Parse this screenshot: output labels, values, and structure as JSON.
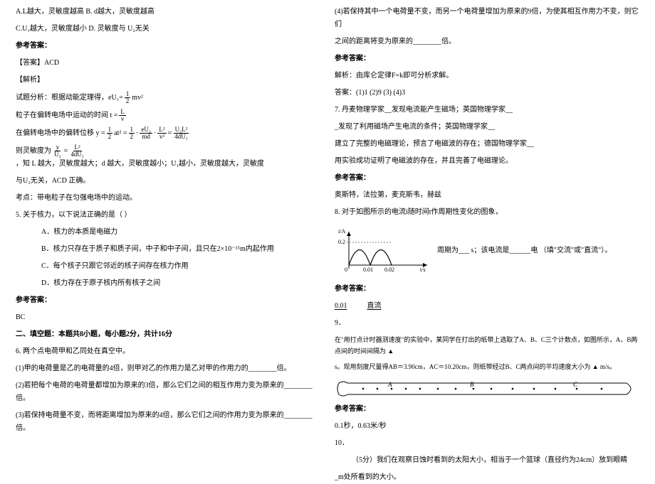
{
  "left": {
    "opt_a_pre": "A.  ",
    "opt_a": "L越大，灵敏度越高    B.  d越大，灵敏度越高",
    "opt_c_pre": "C.  ",
    "opt_c": "U₁越大，灵敏度越小    D. 灵敏度与 U₂无关",
    "ref": "参考答案：",
    "ans_label": "【答案】ACD",
    "analysis": "【解析】",
    "line1_pre": "试题分析：根据动能定理得，eU₁=",
    "line1_num": "1",
    "line1_den": "2",
    "line1_suf": "mv²",
    "line2_pre": "粒子在偏转电场中运动的时间 t =",
    "line2_num": "L",
    "line2_den": "v",
    "line3_pre": "在偏转电场中的偏转位移 y =",
    "f3a_num": "1",
    "f3a_den": "2",
    "line3_mid1": "at² =",
    "f3b_num": "1",
    "f3b_den": "2",
    "line3_mid2": "·",
    "f3c_num": "eU₂",
    "f3c_den": "md",
    "line3_mid3": "·",
    "f3d_num": "L²",
    "f3d_den": "v²",
    "line3_mid4": "=",
    "f3e_num": "U₂L²",
    "f3e_den": "4dU₁",
    "line4_pre": "则灵敏度为",
    "f4a_num": "y",
    "f4a_den": "U₂",
    "line4_mid": "=",
    "f4b_num": "L²",
    "f4b_den": "4dU₁",
    "line4_suf": "，知 L 越大，灵敏度越大；d 越大，灵敏度越小；U₁越小，灵敏度越大，灵敏度",
    "line5": "与U₂无关，ACD 正确。",
    "kaodian": "考点：带电粒子在匀强电场中的运动。",
    "q5": "5. 关于核力，以下说法正确的是（  ）",
    "q5a": "A．核力的本质是电磁力",
    "q5b": "B．核力只存在于质子和质子间，中子和中子间，且只在2×10⁻¹⁵m内起作用",
    "q5c": "C．每个核子只跟它邻近的核子间存在核力作用",
    "q5d": "D．核力存在于原子核内所有核子之间",
    "ref5": "参考答案：",
    "ans5": "BC",
    "section2": "二、填空题：本题共8小题，每小题2分，共计16分",
    "q6": "6. 两个点电荷甲和乙同处在真空中。",
    "q6_1": "(1)甲的电荷量是乙的电荷量的4倍，则甲对乙的作用力是乙对甲的作用力的________倍。",
    "q6_2": "(2)若把每个电荷的电荷量都增加为原来的3倍，那么它们之间的相互作用力变为原来的________倍。",
    "q6_3": "(3)若保持电荷量不变，而将距离增加为原来的4倍，那么它们之间的作用力变为原来的________倍。"
  },
  "right": {
    "q6_4a": "(4)若保持其中一个电荷量不变，而另一个电荷量增加为原来的9倍，为使其相互作用力不变，则它们",
    "q6_4b": "之间的距离将变为原来的________倍。",
    "ref6": "参考答案：",
    "exp6": "解析：由库仑定律F=k即可分析求解。",
    "ans6": "答案：(1)1  (2)9  (3)   (4)3",
    "q7a": "7. 丹麦物理学家__发现电流能产生磁场；英国物理学家__",
    "q7b": "_发现了利用磁场产生电流的条件；英国物理学家__",
    "q7c": "建立了完整的电磁理论，预言了电磁波的存在；德国物理学家__",
    "q7d": "用实验成功证明了电磁波的存在，并且完善了电磁理论。",
    "ref7": "参考答案：",
    "ans7": "奥斯特，法拉第，麦克斯韦，赫兹",
    "q8": "8. 对于如图所示的电流i随时间t作周期性变化的图象，",
    "q8_suf": "周期为___ s；该电流是______电  （填\"交流\"或\"直流\"）。",
    "ref8": "参考答案：",
    "ans8a": "0.01",
    "ans8b": "直流",
    "q9": "9．",
    "q9a": "在\"用打点计时器测速度\"的实验中，某同学在打出的纸带上选取了A、B、C三个计数点，如图所示，A、B两点间的时间间隔为  ▲  ",
    "q9b": "s。现用刻度尺量得AB＝3.90cm，AC＝10.20cm，则纸带经过B、C两点间的平均速度大小为  ▲  m/s。",
    "ref9": "参考答案：",
    "ans9": "0.1秒，0.63米/秒",
    "q10": "10．",
    "q10a": "（5分）我们在观察日蚀时看到的太阳大小，相当于一个篮球（直径约为24cm）放到眼睛",
    "q10b": "_m处所看到的大小。"
  },
  "chart_data": {
    "type": "line",
    "title": "",
    "xlabel": "t/s",
    "ylabel": "i/A",
    "x": [
      0,
      0.005,
      0.01,
      0.015,
      0.02
    ],
    "y": [
      0,
      0.2,
      0,
      0.2,
      0
    ],
    "xlim": [
      0,
      0.02
    ],
    "ylim": [
      0,
      0.2
    ],
    "xticks": [
      0,
      0.01,
      0.02
    ],
    "yticks": [
      0,
      0.2
    ]
  }
}
